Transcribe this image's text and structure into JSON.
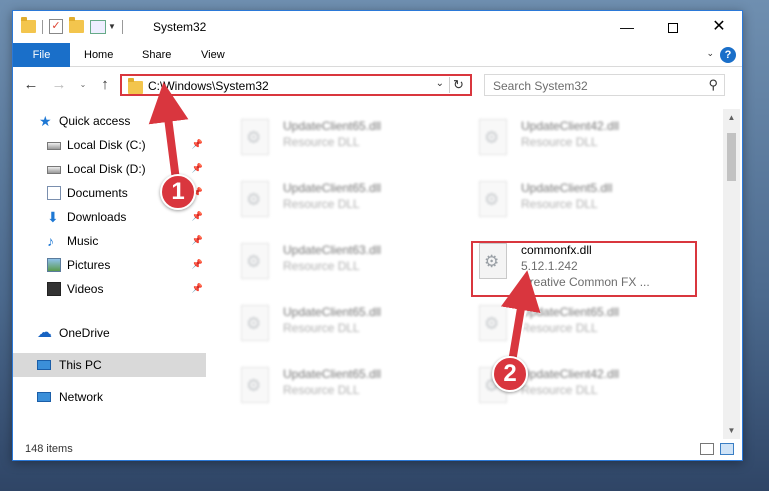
{
  "window": {
    "title": "System32",
    "min_glyph": "—",
    "close_glyph": "✕"
  },
  "ribbon": {
    "tabs": [
      {
        "label": "File"
      },
      {
        "label": "Home"
      },
      {
        "label": "Share"
      },
      {
        "label": "View"
      }
    ],
    "help_glyph": "?"
  },
  "navigation": {
    "back_glyph": "←",
    "forward_glyph": "→",
    "recent_glyph": "⌄",
    "up_glyph": "↑"
  },
  "address_bar": {
    "path": "C:\\Windows\\System32",
    "dropdown_glyph": "⌄",
    "refresh_glyph": "↻"
  },
  "search": {
    "placeholder": "Search System32",
    "icon_glyph": "⚲"
  },
  "sidebar": {
    "items": [
      {
        "label": "Quick access",
        "icon": "star-icon",
        "pinned": false
      },
      {
        "label": "Local Disk (C:)",
        "icon": "drive-icon",
        "pinned": true
      },
      {
        "label": "Local Disk (D:)",
        "icon": "drive-icon",
        "pinned": true
      },
      {
        "label": "Documents",
        "icon": "documents-icon",
        "pinned": true
      },
      {
        "label": "Downloads",
        "icon": "download-arrow-icon",
        "pinned": true
      },
      {
        "label": "Music",
        "icon": "music-note-icon",
        "pinned": true
      },
      {
        "label": "Pictures",
        "icon": "pictures-icon",
        "pinned": true
      },
      {
        "label": "Videos",
        "icon": "film-icon",
        "pinned": true
      },
      {
        "label": "OneDrive",
        "icon": "cloud-icon",
        "pinned": false
      },
      {
        "label": "This PC",
        "icon": "monitor-icon",
        "pinned": false,
        "selected": true
      },
      {
        "label": "Network",
        "icon": "network-icon",
        "pinned": false
      }
    ],
    "pin_glyph": "📌"
  },
  "files": [
    {
      "name": "UpdateClient65.dll",
      "desc": "Resource DLL"
    },
    {
      "name": "UpdateClient42.dll",
      "desc": "Resource DLL"
    },
    {
      "name": "UpdateClient65.dll",
      "desc": "Resource DLL"
    },
    {
      "name": "UpdateClient5.dll",
      "desc": "Resource DLL"
    },
    {
      "name": "UpdateClient63.dll",
      "desc": "Resource DLL"
    },
    {
      "name": "commonfx.dll",
      "desc": "5.12.1.242",
      "extra": "Creative Common FX ...",
      "highlighted": true
    },
    {
      "name": "UpdateClient65.dll",
      "desc": "Resource DLL"
    },
    {
      "name": "UpdateClient65.dll",
      "desc": "Resource DLL"
    },
    {
      "name": "UpdateClient65.dll",
      "desc": "Resource DLL"
    },
    {
      "name": "UpdateClient42.dll",
      "desc": "Resource DLL"
    }
  ],
  "scrollbar": {
    "up_glyph": "▲",
    "down_glyph": "▼"
  },
  "status": {
    "item_count": "148 items"
  },
  "annotations": {
    "step1": "1",
    "step2": "2"
  },
  "colors": {
    "accent": "#1a6fc9",
    "highlight_red": "#d9363e",
    "window_border": "#2b79d8"
  }
}
